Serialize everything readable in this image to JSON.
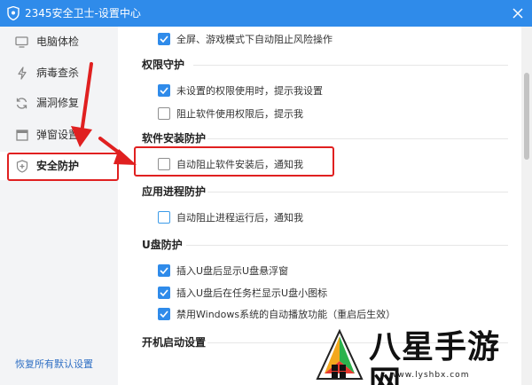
{
  "window": {
    "title": "2345安全卫士-设置中心",
    "close_icon": "close-icon",
    "accent": "#2f8bea"
  },
  "sidebar": {
    "items": [
      {
        "label": "电脑体检",
        "icon": "monitor-icon",
        "active": false
      },
      {
        "label": "病毒查杀",
        "icon": "lightning-icon",
        "active": false
      },
      {
        "label": "漏洞修复",
        "icon": "refresh-icon",
        "active": false
      },
      {
        "label": "弹窗设置",
        "icon": "window-icon",
        "active": false
      },
      {
        "label": "安全防护",
        "icon": "shield-plus-icon",
        "active": true
      }
    ],
    "restore_label": "恢复所有默认设置"
  },
  "main": {
    "top_option": {
      "label": "全屏、游戏模式下自动阻止风险操作",
      "checked": true
    },
    "sections": [
      {
        "title": "权限守护",
        "options": [
          {
            "label": "未设置的权限使用时，提示我设置",
            "checked": true
          },
          {
            "label": "阻止软件使用权限后，提示我",
            "checked": false
          }
        ]
      },
      {
        "title": "软件安装防护",
        "options": [
          {
            "label": "自动阻止软件安装后，通知我",
            "checked": false
          }
        ]
      },
      {
        "title": "应用进程防护",
        "options": [
          {
            "label": "自动阻止进程运行后，通知我",
            "checked": false
          }
        ]
      },
      {
        "title": "U盘防护",
        "options": [
          {
            "label": "插入U盘后显示U盘悬浮窗",
            "checked": true
          },
          {
            "label": "插入U盘后在任务栏显示U盘小图标",
            "checked": true
          },
          {
            "label": "禁用Windows系统的自动播放功能（重启后生效）",
            "checked": true
          }
        ]
      },
      {
        "title": "开机启动设置",
        "options": []
      }
    ]
  },
  "watermark": {
    "text": "八星手游网",
    "url": "www.lyshbx.com"
  },
  "annotations": {
    "highlight_color": "#e02020"
  }
}
